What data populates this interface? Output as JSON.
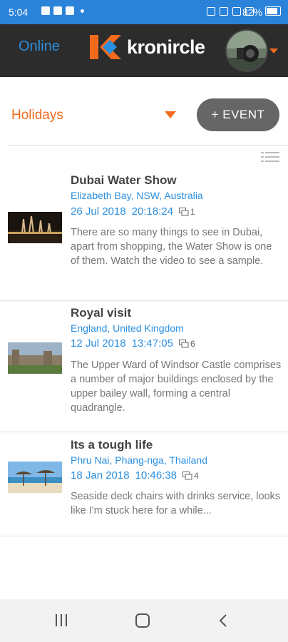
{
  "status_bar": {
    "time": "5:04",
    "battery": "82%"
  },
  "header": {
    "status": "Online",
    "brand": "kronircle"
  },
  "toolbar": {
    "album": "Holidays",
    "add_event_label": "+ EVENT"
  },
  "events": [
    {
      "title": "Dubai Water Show",
      "location": "Elizabeth Bay, NSW, Australia",
      "date": "26 Jul 2018",
      "time": "20:18:24",
      "media_count": "1",
      "description": "There are so many things to see in Dubai, apart from shopping, the Water Show is one of them. Watch the video to see a sample."
    },
    {
      "title": "Royal visit",
      "location": "England, United Kingdom",
      "date": "12 Jul 2018",
      "time": "13:47:05",
      "media_count": "6",
      "description": "The Upper Ward of Windsor Castle comprises a number of major buildings enclosed by the upper bailey wall, forming a central quadrangle."
    },
    {
      "title": "Its a tough life",
      "location": "Phru Nai, Phang-nga, Thailand",
      "date": "18 Jan 2018",
      "time": "10:46:38",
      "media_count": "4",
      "description": "Seaside deck chairs with drinks service, looks like I'm stuck here for a while..."
    }
  ],
  "colors": {
    "accent": "#f26b1d",
    "link": "#2b8fe0",
    "header_bg": "#2c2c2c",
    "status_bar_bg": "#2b83d9"
  }
}
